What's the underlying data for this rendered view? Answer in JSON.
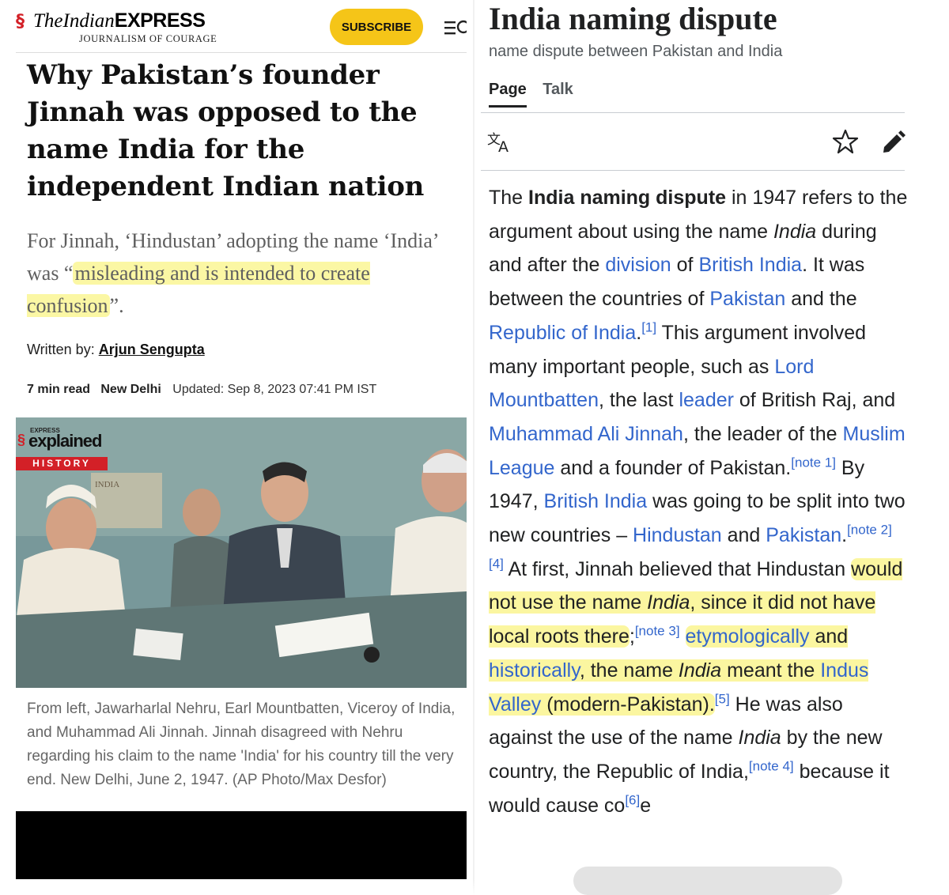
{
  "left_panel": {
    "logo": {
      "the": "The",
      "indian": "Indian",
      "express": "EXPRESS",
      "tagline": "JOURNALISM OF COURAGE"
    },
    "subscribe_label": "SUBSCRIBE",
    "headline": "Why Pakistan’s founder Jinnah was opposed to the name India for the independent Indian nation",
    "subheadline": {
      "before": "For Jinnah, ‘Hindustan’ adopting the name ‘India’ was “",
      "highlighted": "misleading and is intended to create confusion",
      "after": "”."
    },
    "byline": {
      "prefix": "Written by: ",
      "author": "Arjun Sengupta"
    },
    "meta": {
      "read_time": "7 min read",
      "location": "New Delhi",
      "updated": "Updated: Sep 8, 2023 07:41 PM IST"
    },
    "photo_badge": {
      "express": "EXPRESS",
      "explained": "explained",
      "section": "HISTORY"
    },
    "photo_map_text": "INDIA",
    "caption": "From left, Jawarharlal Nehru, Earl Mountbatten, Viceroy of India, and Muhammad Ali Jinnah. Jinnah disagreed with Nehru regarding his claim to the name 'India' for his country till the very end. New Delhi, June 2, 1947. (AP Photo/Max Desfor)"
  },
  "right_panel": {
    "title": "India naming dispute",
    "description": "name dispute between Pakistan and India",
    "tabs": [
      {
        "label": "Page"
      },
      {
        "label": "Talk"
      }
    ],
    "body": {
      "t1": "The ",
      "b1": "India naming dispute",
      "t2": " in 1947 refers to the argument about using the name ",
      "i1": "India",
      "t3": " during and after the ",
      "l_division": "division",
      "t4": " of ",
      "l_british_india": "British India",
      "t5": ". It was between the countries of ",
      "l_pakistan": "Pakistan",
      "t6": " and the ",
      "l_republic": "Republic of India",
      "t7": ".",
      "r1": "[1]",
      "t8": " This argument involved many important people, such as ",
      "l_mountbatten": "Lord Mountbatten",
      "t9": ", the last ",
      "l_leader": "leader",
      "t10": " of British Raj, and ",
      "l_jinnah": "Muhammad Ali Jinnah",
      "t11": ", the leader of the ",
      "l_muslim_league": "Muslim League",
      "t12": " and a founder of Pakistan.",
      "n1": "[note 1]",
      "t13": " By 1947, ",
      "l_british_india2": "British India",
      "t14": " was going to be split into two new countries – ",
      "l_hindustan": "Hindustan",
      "t15": " and ",
      "l_pakistan2": "Pakistan",
      "t16": ".",
      "n2": "[note 2]",
      "r4": "[4]",
      "t17": " At first, Jinnah believed that Hindustan ",
      "h1a": "would not use the name ",
      "h1i": "India",
      "h1b": ", since it did not have local roots there",
      "t18": ";",
      "n3": "[note 3]",
      "l_etym": "etymologically",
      "h2a": " and ",
      "l_hist": "historically",
      "h2b": ", the name ",
      "h2i": "India",
      "h2c": " meant the ",
      "l_indus": "Indus Valley",
      "h2d": " (modern-Pakistan).",
      "r5": "[5]",
      "t19": " He was also against the use of the name ",
      "i2": "India",
      "t20": " by the new country, the Republic of India,",
      "n4": "[note 4]",
      "t21": " because it would cause co",
      "r6": "[6]",
      "t22": "e"
    }
  }
}
